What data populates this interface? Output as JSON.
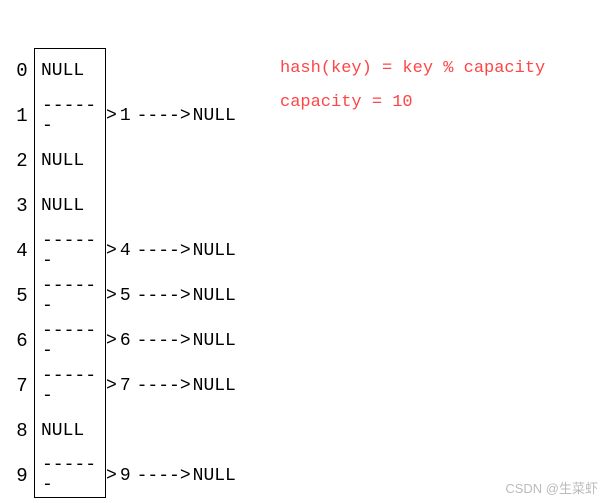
{
  "chart_data": {
    "type": "table",
    "title": "",
    "capacity": 10,
    "hash_function": "hash(key) = key % capacity",
    "buckets": [
      {
        "index": 0,
        "chain": null
      },
      {
        "index": 1,
        "chain": [
          1
        ]
      },
      {
        "index": 2,
        "chain": null
      },
      {
        "index": 3,
        "chain": null
      },
      {
        "index": 4,
        "chain": [
          4
        ]
      },
      {
        "index": 5,
        "chain": [
          5
        ]
      },
      {
        "index": 6,
        "chain": [
          6
        ]
      },
      {
        "index": 7,
        "chain": [
          7
        ]
      },
      {
        "index": 8,
        "chain": null
      },
      {
        "index": 9,
        "chain": [
          9
        ]
      }
    ]
  },
  "labels": {
    "null": "NULL",
    "dash_long": "------",
    "dash_short": "----",
    "arrow": ">",
    "hash_line": "hash(key) = key % capacity",
    "capacity_line": "capacity = 10"
  },
  "watermark": "CSDN @生菜虾"
}
